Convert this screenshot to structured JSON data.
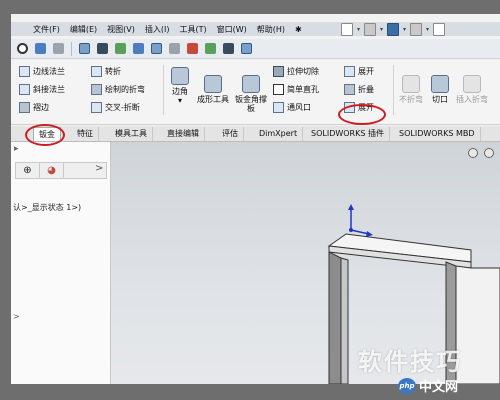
{
  "menu": {
    "items": [
      "文件(F)",
      "编辑(E)",
      "视图(V)",
      "插入(I)",
      "工具(T)",
      "窗口(W)",
      "帮助(H)"
    ]
  },
  "commands": {
    "edge_flange": "边线法兰",
    "miter_flange": "斜接法兰",
    "hem": "褶边",
    "jog": "转折",
    "sketched_bend": "绘制的折弯",
    "cross_break": "交叉-折断",
    "corner": "边角",
    "forming_tool": "成形工具",
    "sheet_metal_gusset": "钣金角撑板",
    "extruded_cut": "拉伸切除",
    "simple_hole": "简单直孔",
    "vent": "通风口",
    "unfold": "展开",
    "fold": "折叠",
    "flatten": "展开",
    "no_bends": "不折弯",
    "rip": "切口",
    "insert_bends": "插入折弯"
  },
  "tabs": [
    "钣金",
    "特征",
    "模具工具",
    "直接编辑",
    "评估",
    "DimXpert",
    "SOLIDWORKS 插件",
    "SOLIDWORKS MBD"
  ],
  "left_panel": {
    "tree_text": "认>_显示状态 1>)",
    "collapse_arrow": ">"
  },
  "watermark": {
    "text": "软件技巧",
    "brand_badge": "php",
    "brand_text": "中文网"
  },
  "colors": {
    "annotation": "#cc1e1e",
    "accent": "#3b77c4"
  }
}
